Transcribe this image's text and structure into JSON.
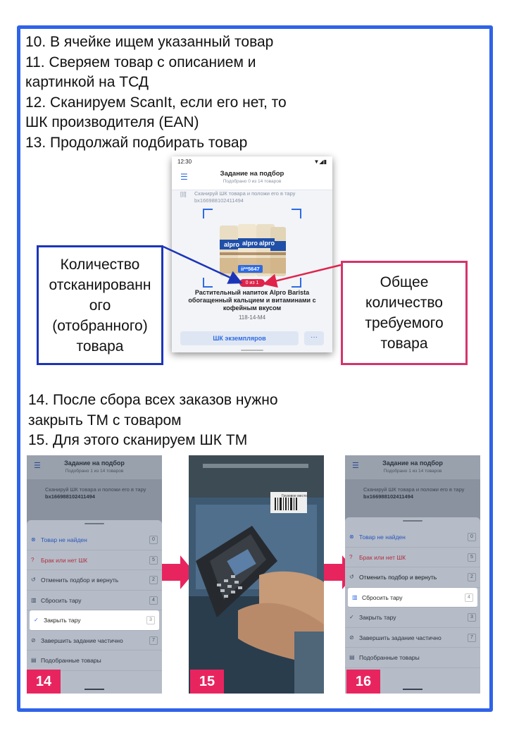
{
  "steps_top": [
    "10. В ячейке ищем указанный товар",
    "11. Сверяем товар с описанием и",
    "картинкой на ТСД",
    "12. Сканируем ScanIt, если его нет, то",
    "ШК производителя (EAN)",
    "13. Продолжай подбирать товар"
  ],
  "steps_mid": [
    "14. После сбора всех заказов нужно",
    "закрыть ТМ с товаром",
    "15. Для этого сканируем ШК ТМ"
  ],
  "phone": {
    "time": "12:30",
    "status_icons": "▼◢▮",
    "title": "Задание на подбор",
    "subtitle": "Подобрано 0 из 14 товаров",
    "scan_hint": "Сканируй ШК товара и положи его в тару bx166988102411494",
    "cell_tag": "ii**5647",
    "count": "0 из 1",
    "product_name": "Растительный напиток Alpro Barista обогащенный кальцием и витаминами с кофейным вкусом",
    "cell_code": "118-14-M4",
    "instances_button": "ШК экземпляров",
    "more_button": "···"
  },
  "callouts": {
    "left": [
      "Количество",
      "отсканированн",
      "ого",
      "(отобранного)",
      "товара"
    ],
    "right": [
      "Общее",
      "количество",
      "требуемого",
      "товара"
    ]
  },
  "screens": {
    "bg_title": "Задание на подбор",
    "bg_sub_14": "Подобрано 1 из 14 товаров",
    "bg_sub_16": "Подобрано 1 из 14 товаров",
    "bg_hint": "Сканируй ШК товара и положи его в тару",
    "bg_hint_code": "bx166988102411494",
    "menu": [
      {
        "label": "Товар не найден",
        "key": "0"
      },
      {
        "label": "Брак или нет ШК",
        "key": "5"
      },
      {
        "label": "Отменить подбор и вернуть",
        "key": "2"
      },
      {
        "label": "Сбросить тару",
        "key": "4"
      },
      {
        "label": "Закрыть тару",
        "key": "3"
      },
      {
        "label": "Завершить задание частично",
        "key": "7"
      },
      {
        "label": "Подобранные товары",
        "key": ""
      }
    ],
    "badges": [
      "14",
      "15",
      "16"
    ],
    "photo_label": "Грузовое место"
  },
  "colors": {
    "frame": "#2f63e8",
    "accent": "#2d6be3",
    "pink": "#e8245f",
    "callout_left": "#1c35b8",
    "callout_right": "#d6336c"
  }
}
